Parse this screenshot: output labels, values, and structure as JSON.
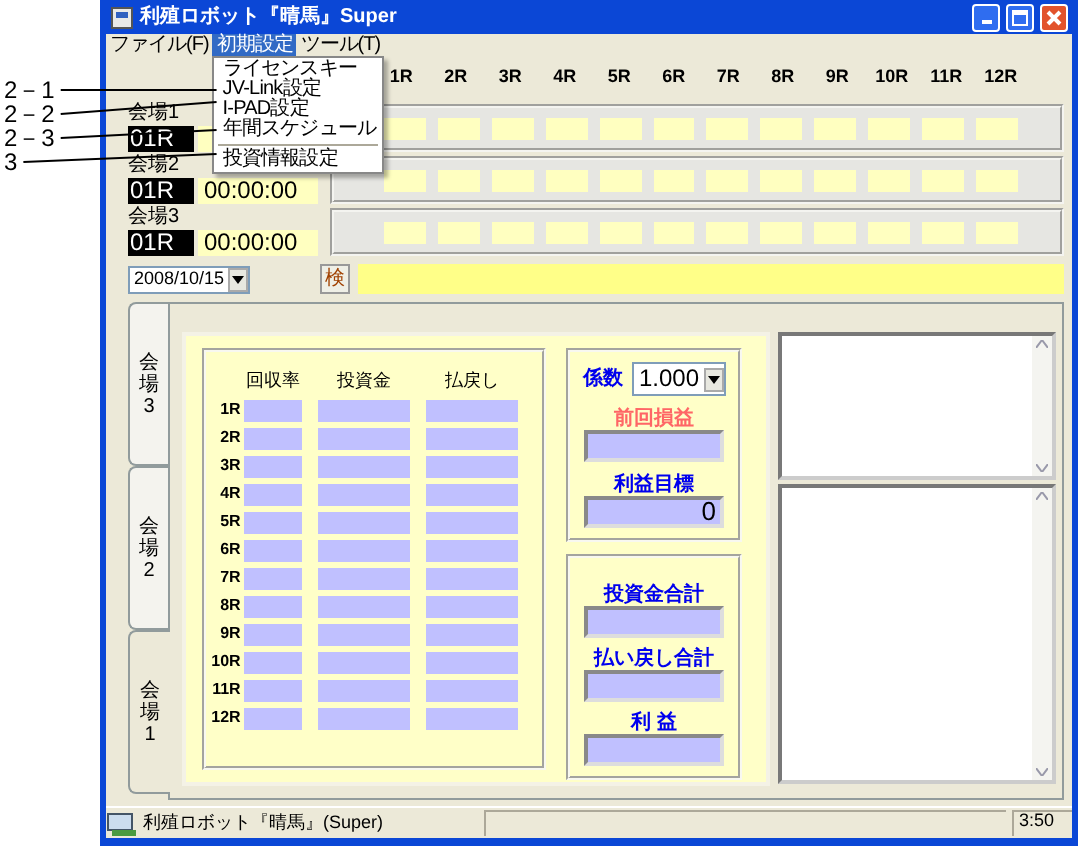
{
  "window": {
    "title": "利殖ロボット『晴馬』Super"
  },
  "menu_bar": [
    {
      "label": "ファイル(F)",
      "selected": false
    },
    {
      "label": "初期設定",
      "selected": true
    },
    {
      "label": "ツール(T)",
      "selected": false
    }
  ],
  "dropdown": [
    {
      "kind": "item",
      "label": "ライセンスキー"
    },
    {
      "kind": "item",
      "label": "JV-Link設定",
      "annotation": "2－1"
    },
    {
      "kind": "item",
      "label": "I-PAD設定",
      "annotation": "2－2"
    },
    {
      "kind": "item",
      "label": "年間スケジュール",
      "annotation": "2－3"
    },
    {
      "kind": "separator"
    },
    {
      "kind": "item",
      "label": "投資情報設定",
      "annotation": "3"
    }
  ],
  "races": [
    "1R",
    "2R",
    "3R",
    "4R",
    "5R",
    "6R",
    "7R",
    "8R",
    "9R",
    "10R",
    "11R",
    "12R"
  ],
  "venues": [
    {
      "label": "会場1",
      "race": "01R"
    },
    {
      "label": "会場2",
      "race": "01R",
      "time": "00:00:00"
    },
    {
      "label": "会場3",
      "race": "01R",
      "time": "00:00:00"
    }
  ],
  "date_picker": {
    "value": "2008/10/15"
  },
  "search_button": "検",
  "tabs": [
    {
      "label": "会場3",
      "selected": false
    },
    {
      "label": "会場2",
      "selected": false
    },
    {
      "label": "会場1",
      "selected": true
    }
  ],
  "grid": {
    "columns": [
      "回収率",
      "投資金",
      "払戻し"
    ],
    "rows": [
      "1R",
      "2R",
      "3R",
      "4R",
      "5R",
      "6R",
      "7R",
      "8R",
      "9R",
      "10R",
      "11R",
      "12R"
    ]
  },
  "coefficient": {
    "label": "係数",
    "value": "1.000"
  },
  "profit_fields": [
    {
      "label": "前回損益",
      "color": "#ff6666"
    },
    {
      "label": "利益目標",
      "color": "#0000ee",
      "value": "0"
    }
  ],
  "totals": [
    {
      "label": "投資金合計"
    },
    {
      "label": "払い戻し合計"
    },
    {
      "label": "利 益"
    }
  ],
  "status_bar": {
    "text": "利殖ロボット『晴馬』(Super)",
    "time": "3:50"
  }
}
